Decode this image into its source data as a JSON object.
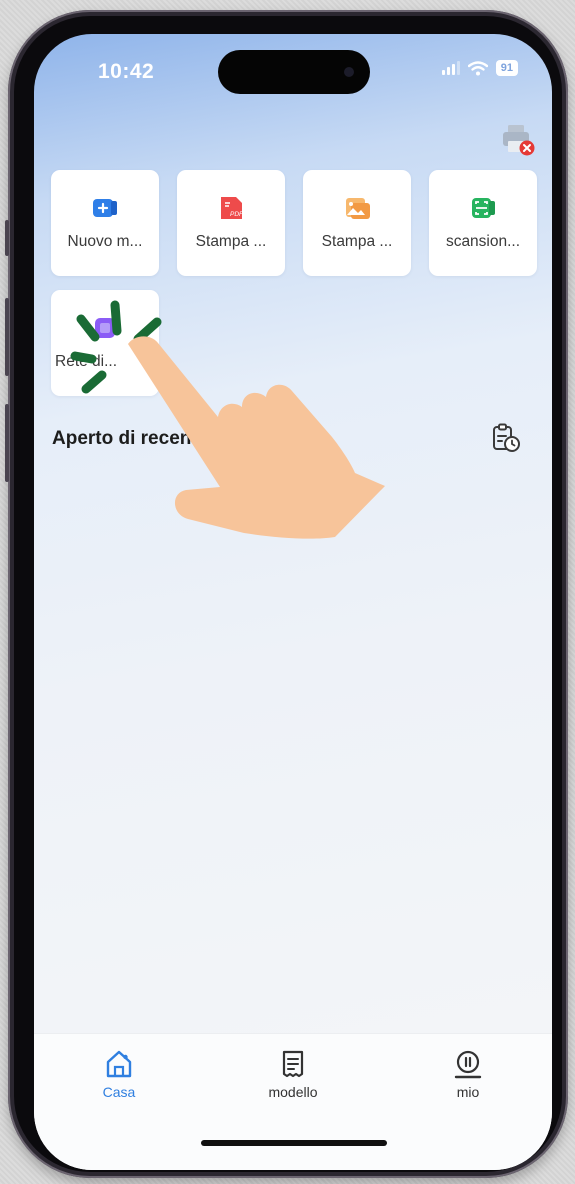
{
  "status": {
    "time": "10:42",
    "battery": "91"
  },
  "quick_actions": [
    {
      "label": "Nuovo m...",
      "icon": "new-document-icon",
      "color": "#2f7fe8"
    },
    {
      "label": "Stampa ...",
      "icon": "pdf-icon",
      "color": "#ee4b4b",
      "badge": "PDF"
    },
    {
      "label": "Stampa ...",
      "icon": "image-icon",
      "color": "#f29a44"
    },
    {
      "label": "scansion...",
      "icon": "scan-icon",
      "color": "#27b45f"
    },
    {
      "label": "Rete di...",
      "icon": "network-icon",
      "color": "#8b5cf6"
    }
  ],
  "recent_section": {
    "title": "Aperto di recente"
  },
  "tabs": [
    {
      "label": "Casa",
      "icon": "home-icon",
      "active": true
    },
    {
      "label": "modello",
      "icon": "template-icon",
      "active": false
    },
    {
      "label": "mio",
      "icon": "profile-icon",
      "active": false
    }
  ],
  "colors": {
    "accent": "#2f7fe0",
    "error_badge": "#e53935"
  }
}
